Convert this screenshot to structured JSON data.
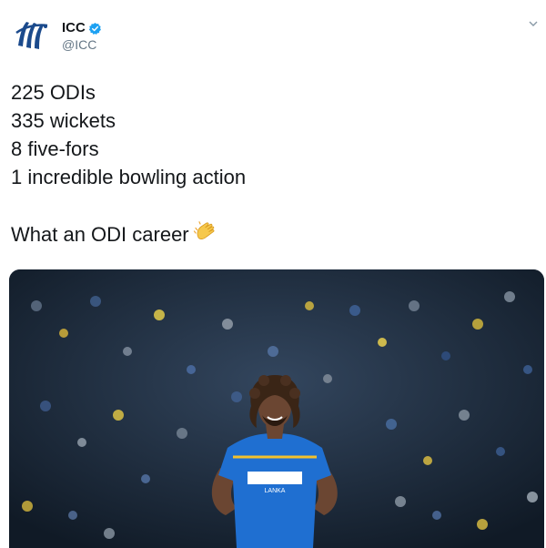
{
  "account": {
    "display_name": "ICC",
    "handle": "@ICC",
    "verified": true,
    "avatar_icon": "icc-logo-icon"
  },
  "menu": {
    "icon": "chevron-down-icon"
  },
  "tweet": {
    "lines": [
      "225 ODIs",
      "335 wickets",
      "8 five-fors",
      "1 incredible bowling action"
    ],
    "closing": "What an ODI career",
    "emoji": "clapping-hands-icon"
  },
  "media": {
    "type": "photo",
    "jersey_text": "LANKA"
  },
  "colors": {
    "verified_blue": "#1da1f2",
    "icc_blue": "#1b4a8c",
    "handle_gray": "#657786",
    "jersey_blue": "#1f6fd1"
  }
}
